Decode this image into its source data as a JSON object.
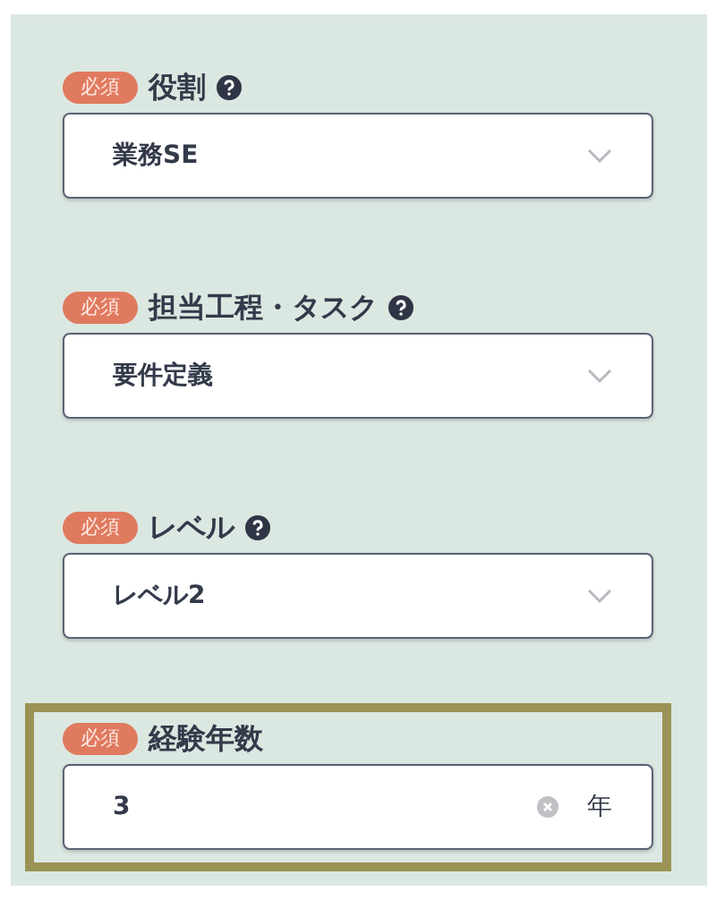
{
  "fields": [
    {
      "kind": "select",
      "badge": "必須",
      "label": "役割",
      "help": true,
      "highlighted": false,
      "value": "業務SE"
    },
    {
      "kind": "select",
      "badge": "必須",
      "label": "担当工程・タスク",
      "help": true,
      "highlighted": false,
      "value": "要件定義"
    },
    {
      "kind": "select",
      "badge": "必須",
      "label": "レベル",
      "help": true,
      "highlighted": false,
      "value": "レベル2"
    },
    {
      "kind": "number",
      "badge": "必須",
      "label": "経験年数",
      "help": false,
      "highlighted": true,
      "value": "3",
      "unit": "年"
    }
  ]
}
